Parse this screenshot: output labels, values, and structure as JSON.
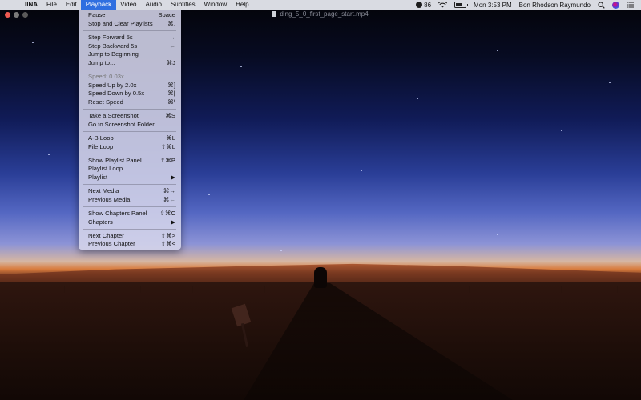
{
  "menubar": {
    "apple": "",
    "app": "IINA",
    "menus": [
      "File",
      "Edit",
      "Playback",
      "Video",
      "Audio",
      "Subtitles",
      "Window",
      "Help"
    ],
    "active_menu": "Playback",
    "status": {
      "badge_count": "86",
      "clock": "Mon 3:53 PM",
      "user": "Bon Rhodson Raymundo"
    }
  },
  "window": {
    "title": "ding_5_0_first_page_start.mp4"
  },
  "playback_menu": {
    "pause": {
      "label": "Pause",
      "shortcut": "Space"
    },
    "stop_clear": {
      "label": "Stop and Clear Playlists",
      "shortcut": "⌘."
    },
    "step_forward": {
      "label": "Step Forward 5s",
      "shortcut": "→"
    },
    "step_backward": {
      "label": "Step Backward 5s",
      "shortcut": "←"
    },
    "jump_beginning": {
      "label": "Jump to Beginning",
      "shortcut": ""
    },
    "jump_to": {
      "label": "Jump to...",
      "shortcut": "⌘J"
    },
    "speed": {
      "label": "Speed: 0.03x"
    },
    "speed_up": {
      "label": "Speed Up by 2.0x",
      "shortcut": "⌘]"
    },
    "speed_down": {
      "label": "Speed Down by 0.5x",
      "shortcut": "⌘["
    },
    "reset_speed": {
      "label": "Reset Speed",
      "shortcut": "⌘\\"
    },
    "screenshot": {
      "label": "Take a Screenshot",
      "shortcut": "⌘S"
    },
    "screenshot_folder": {
      "label": "Go to Screenshot Folder",
      "shortcut": ""
    },
    "ab_loop": {
      "label": "A-B Loop",
      "shortcut": "⌘L"
    },
    "file_loop": {
      "label": "File Loop",
      "shortcut": "⇧⌘L"
    },
    "show_playlist": {
      "label": "Show Playlist Panel",
      "shortcut": "⇧⌘P"
    },
    "playlist_loop": {
      "label": "Playlist Loop",
      "shortcut": ""
    },
    "playlist": {
      "label": "Playlist",
      "shortcut": "▶"
    },
    "next_media": {
      "label": "Next Media",
      "shortcut": "⌘→"
    },
    "prev_media": {
      "label": "Previous Media",
      "shortcut": "⌘←"
    },
    "show_chapters": {
      "label": "Show Chapters Panel",
      "shortcut": "⇧⌘C"
    },
    "chapters": {
      "label": "Chapters",
      "shortcut": "▶"
    },
    "next_chapter": {
      "label": "Next Chapter",
      "shortcut": "⇧⌘>"
    },
    "prev_chapter": {
      "label": "Previous Chapter",
      "shortcut": "⇧⌘<"
    }
  }
}
